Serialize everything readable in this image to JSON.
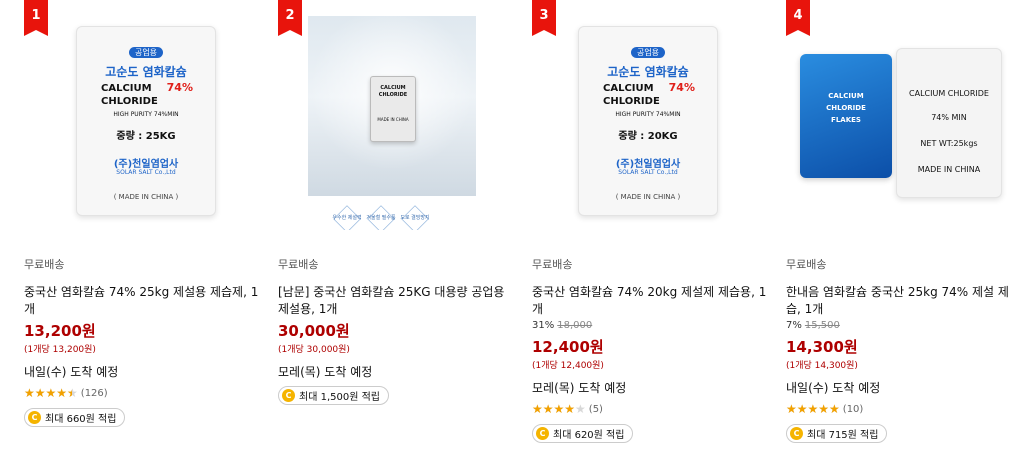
{
  "products": [
    {
      "rank": "1",
      "shipping": "무료배송",
      "title": "중국산 염화칼슘 74% 25kg 제설용 제습제, 1개",
      "discount": "",
      "original_price": "",
      "price": "13,200원",
      "unit_price": "(1개당 13,200원)",
      "delivery": "내일(수) 도착 예정",
      "rating": 4.5,
      "review_count": "(126)",
      "reward": "최대 660원 적립",
      "image": {
        "badge": "공업용",
        "heading": "고순도 염화칼슘",
        "name_line1": "CALCIUM",
        "name_line2": "CHLORIDE",
        "purity": "74%",
        "sub": "HIGH PURITY 74%MIN",
        "weight": "중량 : 25KG",
        "company": "(주)천일염업사",
        "company_en": "SOLAR SALT Co.,Ltd",
        "footer": "( MADE IN CHINA )"
      }
    },
    {
      "rank": "2",
      "shipping": "무료배송",
      "title": "[남문] 중국산 염화칼슘 25KG 대용량 공업용 제설용, 1개",
      "discount": "",
      "original_price": "",
      "price": "30,000원",
      "unit_price": "(1개당 30,000원)",
      "delivery": "모레(목) 도착 예정",
      "rating": null,
      "review_count": "",
      "reward": "최대 1,500원 적립",
      "image": {
        "bag_line1": "CALCIUM",
        "bag_line2": "CHLORIDE",
        "bag_line3": "MADE IN CHINA",
        "icon1": "우수한 제설력",
        "icon2": "겨울철 필수품",
        "icon3": "도로 결빙방지"
      }
    },
    {
      "rank": "3",
      "shipping": "무료배송",
      "title": "중국산 염화칼슘 74% 20kg 제설제 제습용, 1개",
      "discount": "31%",
      "original_price": "18,000",
      "price": "12,400원",
      "unit_price": "(1개당 12,400원)",
      "delivery": "모레(목) 도착 예정",
      "rating": 4.0,
      "review_count": "(5)",
      "reward": "최대 620원 적립",
      "image": {
        "badge": "공업용",
        "heading": "고순도 염화칼슘",
        "name_line1": "CALCIUM",
        "name_line2": "CHLORIDE",
        "purity": "74%",
        "sub": "HIGH PURITY 74%MIN",
        "weight": "중량 : 20KG",
        "company": "(주)천일염업사",
        "company_en": "SOLAR SALT Co.,Ltd",
        "footer": "( MADE IN CHINA )"
      }
    },
    {
      "rank": "4",
      "shipping": "무료배송",
      "title": "한내음 염화칼슘 중국산 25kg 74% 제설 제습, 1개",
      "discount": "7%",
      "original_price": "15,500",
      "price": "14,300원",
      "unit_price": "(1개당 14,300원)",
      "delivery": "내일(수) 도착 예정",
      "rating": 5.0,
      "review_count": "(10)",
      "reward": "최대 715원 적립",
      "image": {
        "blue_line1": "CALCIUM",
        "blue_line2": "CHLORIDE",
        "blue_line3": "FLAKES",
        "white_line1": "CALCIUM CHLORIDE",
        "white_line2": "74% MIN",
        "white_line3": "NET WT:25kgs",
        "white_line4": "MADE IN CHINA"
      }
    }
  ],
  "colors": {
    "rank_bg": "#e8140c",
    "price": "#ae0000",
    "star": "#f2a100",
    "coin": "#f5b400"
  }
}
